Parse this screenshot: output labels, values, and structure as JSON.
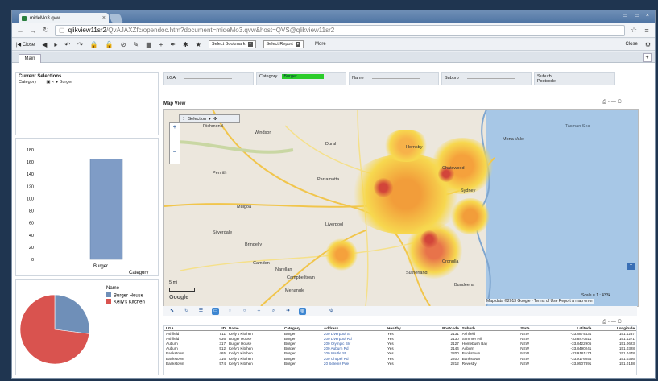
{
  "browser": {
    "tab_title": "mideMo3.qvw",
    "tab_close": "×",
    "window_controls": "▭ ▭ ×",
    "url_host": "qlikview11sr2",
    "url_rest": "/QvAJAXZfc/opendoc.htm?document=mideMo3.qvw&host=QVS@qlikview11sr2",
    "star": "☆",
    "menu": "≡"
  },
  "toolbar": {
    "close_left": "Close",
    "select_bookmark": "Select Bookmark",
    "select_report": "Select Report",
    "more": "+ More",
    "close_right": "Close"
  },
  "sheet_tab": "Main",
  "current_selections": {
    "title": "Current Selections",
    "field": "Category",
    "value": "Burger"
  },
  "filters": [
    {
      "label": "LGA"
    },
    {
      "label": "Category",
      "value": "Burger"
    },
    {
      "label": "Name"
    },
    {
      "label": "Suburb"
    },
    {
      "label": "Suburb",
      "label2": "Postcode"
    }
  ],
  "bar_chart": {
    "y_ticks": [
      "180",
      "160",
      "140",
      "120",
      "100",
      "80",
      "60",
      "40",
      "20",
      "0"
    ],
    "xlabel": "Burger",
    "dimension": "Category"
  },
  "pie_chart": {
    "legend_title": "Name",
    "legend": [
      {
        "label": "Burger House",
        "color": "#6f8fb8"
      },
      {
        "label": "Kelly's Kitchen",
        "color": "#d9534f"
      }
    ]
  },
  "chart_data": [
    {
      "type": "bar",
      "categories": [
        "Burger"
      ],
      "values": [
        165
      ],
      "title": "",
      "xlabel": "Category",
      "ylabel": "",
      "ylim": [
        0,
        180
      ]
    },
    {
      "type": "pie",
      "categories": [
        "Burger House",
        "Kelly's Kitchen"
      ],
      "values": [
        27,
        73
      ],
      "colors": [
        "#6f8fb8",
        "#d9534f"
      ]
    }
  ],
  "map": {
    "title": "Map View",
    "selection_label": "Selection",
    "sea_label": "Tasman Sea",
    "place_labels": [
      "Windsor",
      "Mona Vale",
      "Penrith",
      "Parramatta",
      "Sydney",
      "Campbelltown",
      "Liverpool",
      "Sutherland",
      "Richmond",
      "Dural",
      "Mulgoa",
      "Silverdale",
      "Camden",
      "Narellan",
      "Bringelly",
      "Menangle",
      "Bundeena",
      "Hornsby",
      "Chatswood",
      "Cronulla"
    ],
    "scale_text": "5 mi",
    "google": "Google",
    "attribution": "Map data ©2013 Google - Terms of Use   Report a map error",
    "scale_ratio": "Scale = 1 : 433k"
  },
  "table": {
    "headers": [
      "LGA",
      "ID",
      "Name",
      "Category",
      "Address",
      "Healthy",
      "Postcode",
      "Suburb",
      "State",
      "Latitude",
      "Longitude"
    ],
    "rows": [
      [
        "Ashfield",
        "511",
        "Kelly's Kitchen",
        "Burger",
        "200 Liverpool St",
        "Yes",
        "2131",
        "Ashfield",
        "NSW",
        "-33.8874431",
        "151.1237"
      ],
      [
        "Ashfield",
        "636",
        "Burger House",
        "Burger",
        "200 Liverpool Rd",
        "Yes",
        "2130",
        "Summer Hill",
        "NSW",
        "-33.8870511",
        "151.1271"
      ],
      [
        "Auburn",
        "317",
        "Burger House",
        "Burger",
        "200 Olympic Blv",
        "Yes",
        "2127",
        "Homebush Bay",
        "NSW",
        "-33.8422905",
        "151.0623"
      ],
      [
        "Auburn",
        "512",
        "Kelly's Kitchen",
        "Burger",
        "200 Auburn Rd",
        "Yes",
        "2144",
        "Auburn",
        "NSW",
        "-33.8490241",
        "151.0328"
      ],
      [
        "Bankstown",
        "465",
        "Kelly's Kitchen",
        "Burger",
        "200 Wattle St",
        "Yes",
        "2200",
        "Bankstown",
        "NSW",
        "-33.9181173",
        "151.0478"
      ],
      [
        "Bankstown",
        "316",
        "Kelly's Kitchen",
        "Burger",
        "200 Chapel Rd",
        "Yes",
        "2200",
        "Bankstown",
        "NSW",
        "-33.9176054",
        "151.0356"
      ],
      [
        "Bankstown",
        "574",
        "Kelly's Kitchen",
        "Burger",
        "20 Selems Pde",
        "Yes",
        "2212",
        "Revesby",
        "NSW",
        "-33.9507891",
        "151.0138"
      ]
    ]
  }
}
